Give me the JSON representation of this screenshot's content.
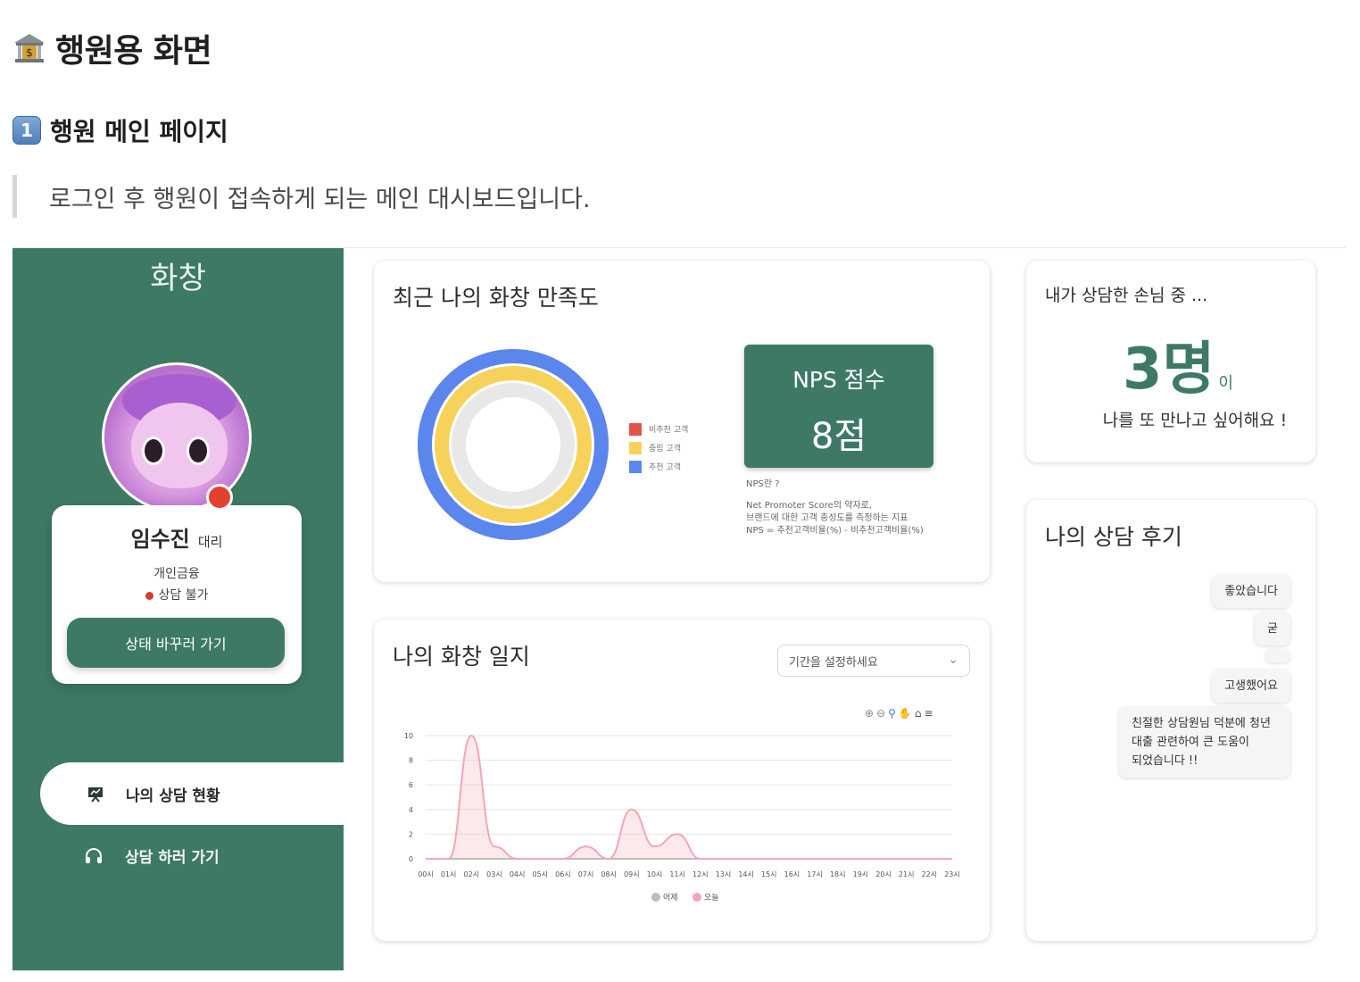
{
  "doc": {
    "title": "행원용 화면",
    "section": "행원 메인 페이지",
    "section_number": "1",
    "quote": "로그인 후 행원이 접속하게 되는 메인 대시보드입니다."
  },
  "sidebar": {
    "logo": "화창",
    "profile": {
      "name": "임수진",
      "rank": "대리",
      "department": "개인금융",
      "status": "상담 불가",
      "change_button": "상태 바꾸러 가기"
    },
    "nav": [
      {
        "label": "나의 상담 현황",
        "icon": "presentation-icon",
        "active": true
      },
      {
        "label": "상담 하러 가기",
        "icon": "headset-icon",
        "active": false
      }
    ]
  },
  "satisfaction": {
    "title": "최근 나의 화창 만족도",
    "legend": [
      "비추천 고객",
      "중립 고객",
      "추천 고객"
    ],
    "nps_title": "NPS 점수",
    "nps_value": "8점",
    "nps_note": [
      "NPS란 ?",
      "Net Promoter Score의 약자로,",
      "브랜드에 대한 고객 충성도를 측정하는 지표",
      "NPS = 추천고객비율(%) - 비추천고객비율(%)"
    ],
    "colors": {
      "detractor": "#e0534a",
      "passive": "#f7d25a",
      "promoter": "#5b86ee",
      "inner": "#e8e8e8"
    }
  },
  "customers": {
    "title": "내가 상담한 손님 중 ...",
    "count": "3명",
    "suffix": "이",
    "message": "나를 또 만나고 싶어해요 !"
  },
  "diary": {
    "title": "나의 화창 일지",
    "period_placeholder": "기간을 설정하세요"
  },
  "reviews": {
    "title": "나의 상담 후기",
    "items": [
      "좋았습니다",
      "굳",
      "",
      "고생했어요",
      "친절한 상담원님 덕분에 청년\n대출 관련하여 큰 도움이\n되었습니다 !!"
    ]
  },
  "chart_data": {
    "type": "area",
    "x": [
      "00시",
      "01시",
      "02시",
      "03시",
      "04시",
      "05시",
      "06시",
      "07시",
      "08시",
      "09시",
      "10시",
      "11시",
      "12시",
      "13시",
      "14시",
      "15시",
      "16시",
      "17시",
      "18시",
      "19시",
      "20시",
      "21시",
      "22시",
      "23시"
    ],
    "series": [
      {
        "name": "어제",
        "values": [
          0,
          0,
          0,
          0,
          0,
          0,
          0,
          0,
          0,
          0,
          0,
          0,
          0,
          0,
          0,
          0,
          0,
          0,
          0,
          0,
          0,
          0,
          0,
          0
        ],
        "color": "#bdbdbd"
      },
      {
        "name": "오늘",
        "values": [
          0,
          0,
          10,
          1,
          0,
          0,
          0,
          1,
          0,
          4,
          1,
          2,
          0,
          0,
          0,
          0,
          0,
          0,
          0,
          0,
          0,
          0,
          0,
          0
        ],
        "color": "#f2a7b4"
      }
    ],
    "yticks": [
      0,
      2,
      4,
      6,
      8,
      10
    ],
    "ylim": [
      0,
      10
    ],
    "grid": true,
    "legend": "bottom"
  }
}
